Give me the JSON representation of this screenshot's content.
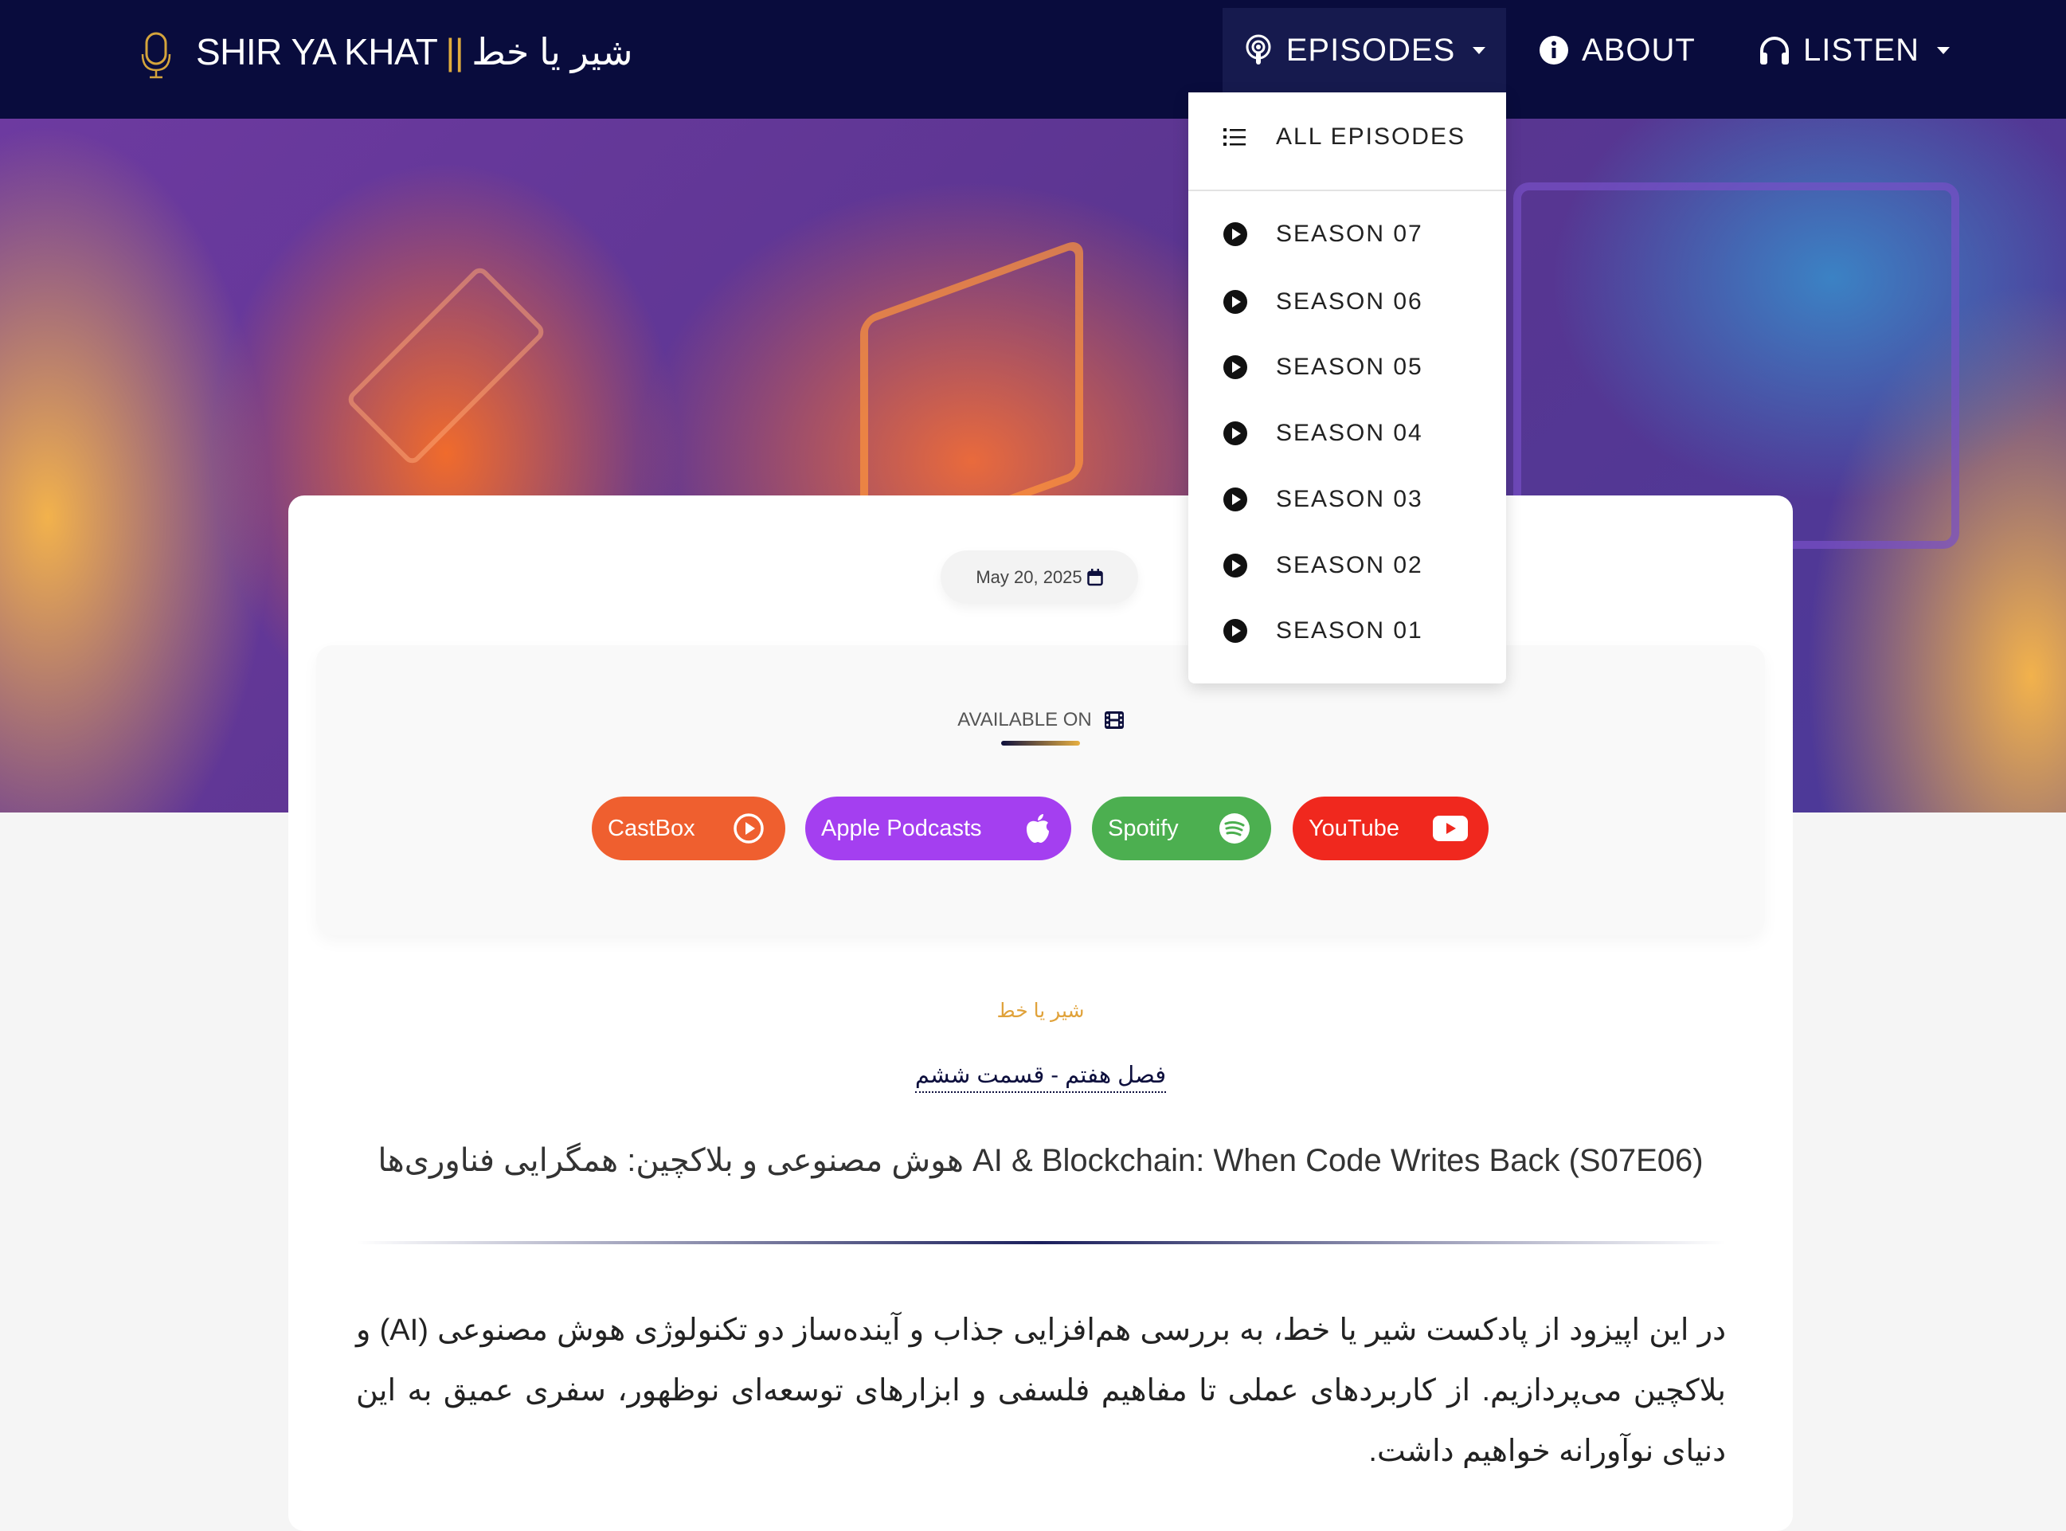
{
  "nav": {
    "brand_en": "SHIR YA KHAT",
    "brand_sep": "||",
    "brand_fa": "شیر یا خط",
    "items": [
      {
        "label": "EPISODES",
        "icon": "podcast-icon"
      },
      {
        "label": "ABOUT",
        "icon": "info-icon"
      },
      {
        "label": "LISTEN",
        "icon": "headphones-icon"
      }
    ]
  },
  "dropdown": {
    "all": "ALL EPISODES",
    "seasons": [
      "SEASON 07",
      "SEASON 06",
      "SEASON 05",
      "SEASON 04",
      "SEASON 03",
      "SEASON 02",
      "SEASON 01"
    ]
  },
  "episode": {
    "date": "May 20, 2025",
    "available_on": "AVAILABLE ON",
    "platforms": [
      {
        "label": "CastBox",
        "color": "#ef5f2f"
      },
      {
        "label": "Apple Podcasts",
        "color": "#a43ff0"
      },
      {
        "label": "Spotify",
        "color": "#4caf50"
      },
      {
        "label": "YouTube",
        "color": "#f0281e"
      }
    ],
    "category": "شیر یا خط",
    "subtitle": "فصل هفتم - قسمت ششم",
    "title_fa": "هوش مصنوعی و بلاکچین: همگرایی فناوری‌ها",
    "title_en": "AI & Blockchain: When Code Writes Back (S07E06)",
    "description": "در این اپیزود از پادکست شیر یا خط، به بررسی هم‌افزایی جذاب و آینده‌ساز دو تکنولوژی هوش مصنوعی (AI) و بلاکچین می‌پردازیم. از کاربردهای عملی تا مفاهیم فلسفی و ابزارهای توسعه‌ای نوظهور، سفری عمیق به این دنیای نوآورانه خواهیم داشت."
  },
  "colors": {
    "nav": "#090c3d",
    "accent": "#e0ac3c"
  }
}
